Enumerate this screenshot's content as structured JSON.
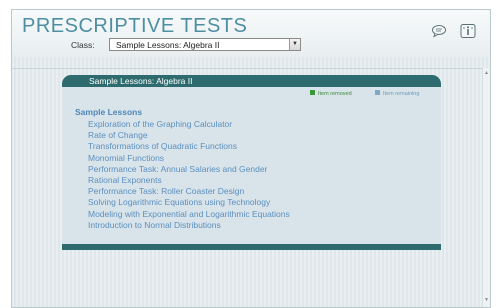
{
  "header": {
    "title": "PRESCRIPTIVE TESTS",
    "class_label": "Class:",
    "class_select_value": "Sample Lessons: Algebra II",
    "icons": [
      "chat-icon",
      "info-icon"
    ]
  },
  "panel": {
    "title": "Sample Lessons: Algebra II",
    "legend": {
      "removed": "Item removed",
      "remaining": "Item remaining"
    },
    "section_heading": "Sample Lessons",
    "lessons": [
      "Exploration of the Graphing Calculator",
      "Rate of Change",
      "Transformations of Quadratic Functions",
      "Monomial Functions",
      "Performance Task: Annual Salaries and Gender",
      "Rational Exponents",
      "Performance Task: Roller Coaster Design",
      "Solving Logarithmic Equations using Technology",
      "Modeling with Exponential and Logarithmic Equations",
      "Introduction to Normal Distributions"
    ]
  },
  "colors": {
    "accent": "#4e8ea1",
    "panel_header": "#2e6b6e",
    "link": "#5b8fbf",
    "removed": "#3a9a3a",
    "remaining": "#7ea8c6"
  }
}
